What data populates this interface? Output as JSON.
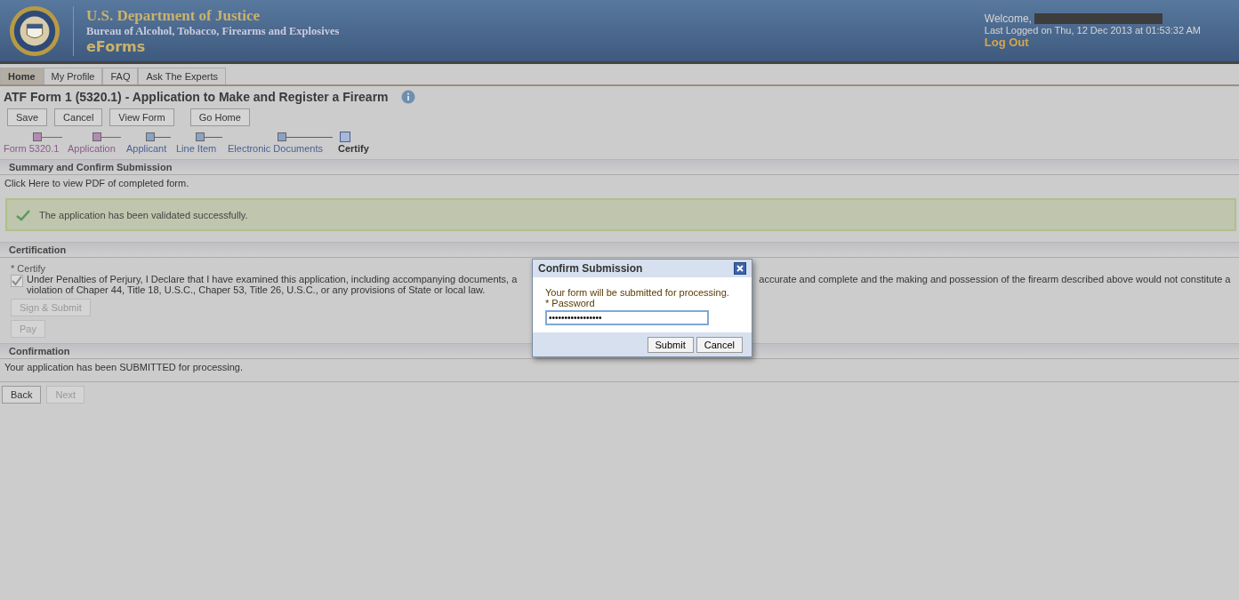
{
  "header": {
    "department": "U.S. Department of Justice",
    "bureau": "Bureau of Alcohol, Tobacco, Firearms and Explosives",
    "app_name": "eForms",
    "welcome": "Welcome,",
    "last_logged": "Last Logged on Thu, 12 Dec 2013 at 01:53:32 AM",
    "logout": "Log Out"
  },
  "tabs": [
    {
      "label": "Home",
      "selected": true
    },
    {
      "label": "My Profile",
      "selected": false
    },
    {
      "label": "FAQ",
      "selected": false
    },
    {
      "label": "Ask The Experts",
      "selected": false
    }
  ],
  "page_title": "ATF Form 1 (5320.1) - Application to Make and Register a Firearm",
  "toolbar": [
    "Save",
    "Cancel",
    "View Form",
    "Go Home"
  ],
  "steps": [
    {
      "label": "Form 5320.1",
      "kind": "visited"
    },
    {
      "label": "Application",
      "kind": "visited"
    },
    {
      "label": "Applicant",
      "kind": "available"
    },
    {
      "label": "Line Item",
      "kind": "available"
    },
    {
      "label": "Electronic Documents",
      "kind": "available"
    },
    {
      "label": "Certify",
      "kind": "current"
    }
  ],
  "summary": {
    "heading": "Summary and Confirm Submission",
    "pdf_link": "Click Here to view PDF of completed form.",
    "message": "The application has been validated successfully."
  },
  "certification": {
    "heading": "Certification",
    "label": "* Certify",
    "checked": true,
    "text_start": "Under Penalties of Perjury, I Declare that I have examined this application, including accompanying documents, a",
    "text_right": "accurate and complete and the making and possession of the firearm described above would not constitute a",
    "text_line2": "violation of Chaper 44, Title 18, U.S.C., Chaper 53, Title 26, U.S.C., or any provisions of State or local law.",
    "buttons": [
      {
        "label": "Sign & Submit",
        "disabled": true
      },
      {
        "label": "Pay",
        "disabled": true
      }
    ]
  },
  "confirmation": {
    "heading": "Confirmation",
    "text": "Your application has been SUBMITTED for processing."
  },
  "nav_buttons": [
    {
      "label": "Back",
      "disabled": false
    },
    {
      "label": "Next",
      "disabled": true
    }
  ],
  "dialog": {
    "title": "Confirm Submission",
    "message": "Your form will be submitted for processing.",
    "field_label": "* Password",
    "value": "•••••••••••••••••",
    "buttons": [
      "Submit",
      "Cancel"
    ]
  }
}
